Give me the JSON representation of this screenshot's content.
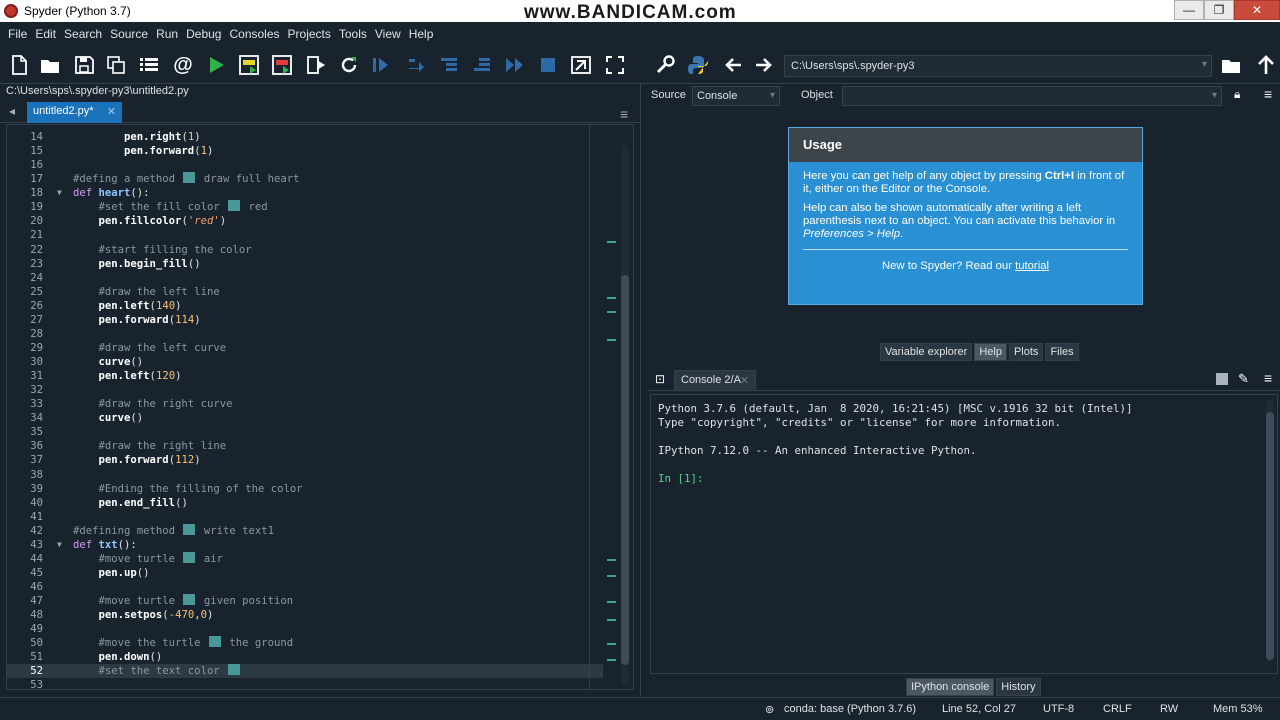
{
  "window": {
    "title": "Spyder (Python 3.7)",
    "watermark": "www.BANDICAM.com",
    "controls": [
      "—",
      "❐",
      "✕"
    ]
  },
  "menubar": [
    "File",
    "Edit",
    "Search",
    "Source",
    "Run",
    "Debug",
    "Consoles",
    "Projects",
    "Tools",
    "View",
    "Help"
  ],
  "toolbar": {
    "icons": [
      "new-file-icon",
      "open-folder-icon",
      "save-icon",
      "save-all-icon",
      "outline-icon",
      "at-icon",
      "run-icon",
      "run-cell-icon",
      "run-cell-advance-icon",
      "run-selection-icon",
      "rerun-icon",
      "debug-icon",
      "step-icon",
      "step-into-icon",
      "step-return-icon",
      "continue-icon",
      "stop-icon",
      "maximize-pane-icon",
      "fullscreen-icon",
      "wrench-icon",
      "python-path-icon",
      "back-arrow-icon",
      "forward-arrow-icon",
      "browse-folder-icon",
      "parent-folder-icon"
    ],
    "working_dir": "C:\\Users\\sps\\.spyder-py3"
  },
  "editor": {
    "file_path": "C:\\Users\\sps\\.spyder-py3\\untitled2.py",
    "tab_label": "untitled2.py*",
    "current_line": 52,
    "lines": [
      {
        "n": "14",
        "t": "        pen.right(1)"
      },
      {
        "n": "15",
        "t": "        pen.forward(1)"
      },
      {
        "n": "16",
        "t": ""
      },
      {
        "n": "17",
        "t": "#defing a method ▪ draw full heart"
      },
      {
        "n": "18",
        "t": "def heart():"
      },
      {
        "n": "19",
        "t": "    #set the fill color ▪ red"
      },
      {
        "n": "20",
        "t": "    pen.fillcolor('red')"
      },
      {
        "n": "21",
        "t": ""
      },
      {
        "n": "22",
        "t": "    #start filling the color"
      },
      {
        "n": "23",
        "t": "    pen.begin_fill()"
      },
      {
        "n": "24",
        "t": ""
      },
      {
        "n": "25",
        "t": "    #draw the left line"
      },
      {
        "n": "26",
        "t": "    pen.left(140)"
      },
      {
        "n": "27",
        "t": "    pen.forward(114)"
      },
      {
        "n": "28",
        "t": ""
      },
      {
        "n": "29",
        "t": "    #draw the left curve"
      },
      {
        "n": "30",
        "t": "    curve()"
      },
      {
        "n": "31",
        "t": "    pen.left(120)"
      },
      {
        "n": "32",
        "t": ""
      },
      {
        "n": "33",
        "t": "    #draw the right curve"
      },
      {
        "n": "34",
        "t": "    curve()"
      },
      {
        "n": "35",
        "t": ""
      },
      {
        "n": "36",
        "t": "    #draw the right line"
      },
      {
        "n": "37",
        "t": "    pen.forward(112)"
      },
      {
        "n": "38",
        "t": ""
      },
      {
        "n": "39",
        "t": "    #Ending the filling of the color"
      },
      {
        "n": "40",
        "t": "    pen.end_fill()"
      },
      {
        "n": "41",
        "t": ""
      },
      {
        "n": "42",
        "t": "#defining method ▪ write text1"
      },
      {
        "n": "43",
        "t": "def txt():"
      },
      {
        "n": "44",
        "t": "    #move turtle ▪ air"
      },
      {
        "n": "45",
        "t": "    pen.up()"
      },
      {
        "n": "46",
        "t": ""
      },
      {
        "n": "47",
        "t": "    #move turtle ▪ given position"
      },
      {
        "n": "48",
        "t": "    pen.setpos(-470,0)"
      },
      {
        "n": "49",
        "t": ""
      },
      {
        "n": "50",
        "t": "    #move the turtle ▪ the ground"
      },
      {
        "n": "51",
        "t": "    pen.down()"
      },
      {
        "n": "52",
        "t": "    #set the text color ▪"
      },
      {
        "n": "53",
        "t": ""
      }
    ]
  },
  "help": {
    "source_label": "Source",
    "source_value": "Console",
    "object_label": "Object",
    "object_value": "",
    "usage_title": "Usage",
    "para1_a": "Here you can get help of any object by pressing ",
    "para1_key": "Ctrl+I",
    "para1_b": " in front of it, either on the Editor or the Console.",
    "para2_a": "Help can also be shown automatically after writing a left parenthesis next to an object. You can activate this behavior in ",
    "para2_pref": "Preferences > Help",
    "para2_b": ".",
    "new_text": "New to Spyder? Read our ",
    "tutorial_link": "tutorial",
    "pane_tabs": [
      "Variable explorer",
      "Help",
      "Plots",
      "Files"
    ],
    "active_pane_tab": "Help"
  },
  "console": {
    "tab_label": "Console 2/A",
    "lines": [
      "Python 3.7.6 (default, Jan  8 2020, 16:21:45) [MSC v.1916 32 bit (Intel)]",
      "Type \"copyright\", \"credits\" or \"license\" for more information.",
      "",
      "IPython 7.12.0 -- An enhanced Interactive Python.",
      "",
      "In [1]:"
    ],
    "bottom_tabs": [
      "IPython console",
      "History"
    ],
    "active_bottom_tab": "IPython console"
  },
  "statusbar": {
    "env": "conda: base (Python 3.7.6)",
    "position": "Line 52, Col 27",
    "encoding": "UTF-8",
    "eol": "CRLF",
    "mode": "RW",
    "memory": "Mem 53%"
  },
  "colors": {
    "background": "#19232d",
    "tab_active": "#1a72bb",
    "usage_panel": "#2990d4",
    "prompt": "#5bd08a"
  }
}
